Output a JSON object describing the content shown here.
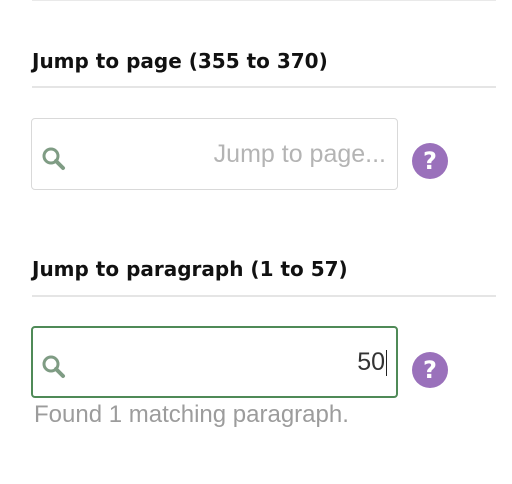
{
  "page_jump": {
    "heading": "Jump to page (355 to 370)",
    "placeholder": "Jump to page...",
    "value": "",
    "search_icon": "search-icon",
    "help_icon": "help-icon",
    "help_glyph": "?"
  },
  "paragraph_jump": {
    "heading": "Jump to paragraph (1 to 57)",
    "placeholder": "",
    "value": "50",
    "search_icon": "search-icon",
    "help_icon": "help-icon",
    "help_glyph": "?",
    "status": "Found 1 matching paragraph."
  },
  "colors": {
    "icon_green": "#7f9c84",
    "focus_border": "#4f8a57",
    "help_purple": "#9a71bb"
  }
}
